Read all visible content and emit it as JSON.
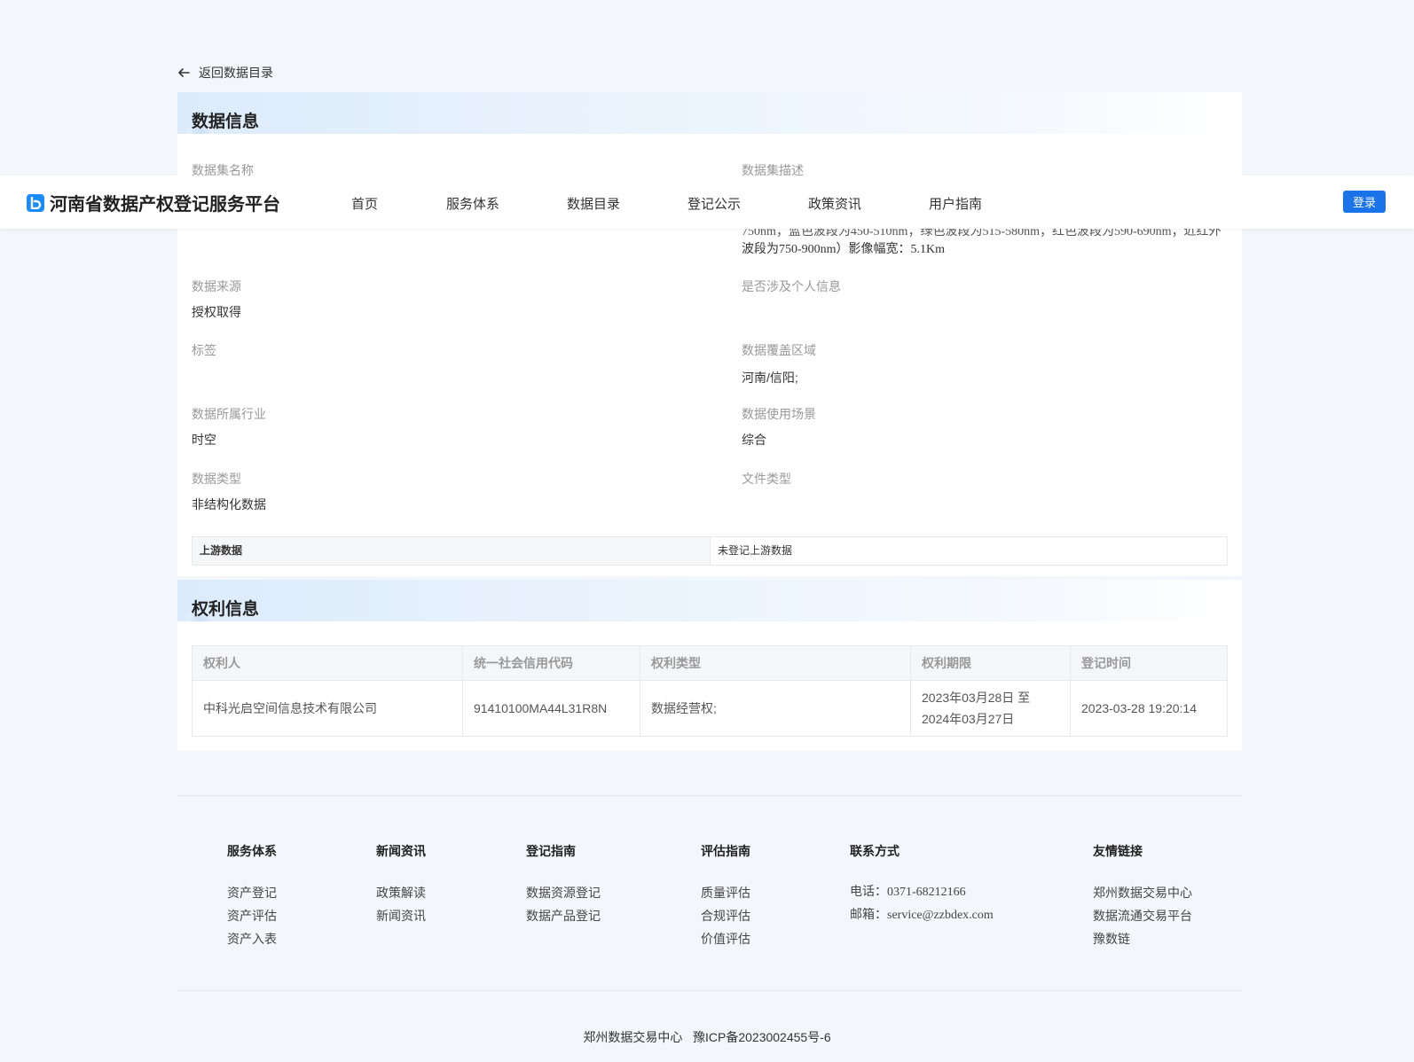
{
  "back": {
    "label": "返回数据目录"
  },
  "nav": {
    "brand": "河南省数据产权登记服务平台",
    "items": [
      "首页",
      "服务体系",
      "数据目录",
      "登记公示",
      "政策资讯",
      "用户指南"
    ],
    "login": "登录"
  },
  "info": {
    "title": "数据信息",
    "name_label": "数据集名称",
    "desc_label": "数据集描述",
    "desc_line_clipped": "750nm；蓝色波段为450-510nm；绿色波段为515-580nm；红色波段为590-690nm；近红外",
    "desc_line_last": "波段为750-900nm）影像幅宽：5.1Km",
    "source_label": "数据来源",
    "source_value": "授权取得",
    "personal_label": "是否涉及个人信息",
    "personal_value": "",
    "tag_label": "标签",
    "tag_value": "",
    "area_label": "数据覆盖区域",
    "area_value": "河南/信阳;",
    "industry_label": "数据所属行业",
    "industry_value": "时空",
    "scene_label": "数据使用场景",
    "scene_value": "综合",
    "type_label": "数据类型",
    "type_value": "非结构化数据",
    "file_label": "文件类型",
    "file_value": "",
    "upstream_key": "上游数据",
    "upstream_value": "未登记上游数据"
  },
  "rights": {
    "title": "权利信息",
    "headers": [
      "权利人",
      "统一社会信用代码",
      "权利类型",
      "权利期限",
      "登记时间"
    ],
    "row": {
      "holder": "中科光启空间信息技术有限公司",
      "code": "91410100MA44L31R8N",
      "type": "数据经营权;",
      "period_start": "2023年03月28日 至",
      "period_end": "2024年03月27日",
      "time": "2023-03-28 19:20:14"
    }
  },
  "footer": {
    "cols": [
      {
        "head": "服务体系",
        "items": [
          "资产登记",
          "资产评估",
          "资产入表"
        ]
      },
      {
        "head": "新闻资讯",
        "items": [
          "政策解读",
          "新闻资讯"
        ]
      },
      {
        "head": "登记指南",
        "items": [
          "数据资源登记",
          "数据产品登记"
        ]
      },
      {
        "head": "评估指南",
        "items": [
          "质量评估",
          "合规评估",
          "价值评估"
        ]
      },
      {
        "head": "联系方式",
        "items": [
          "电话：0371-68212166",
          "邮箱：service@zzbdex.com"
        ]
      },
      {
        "head": "友情链接",
        "items": [
          "郑州数据交易中心",
          "数据流通交易平台",
          "豫数链"
        ]
      }
    ],
    "copyright": "郑州数据交易中心   豫ICP备2023002455号-6"
  },
  "colors": {
    "accent": "#1a73e8",
    "brand_logo": "#1a8cff",
    "page_bg": "#f3f6fb"
  }
}
